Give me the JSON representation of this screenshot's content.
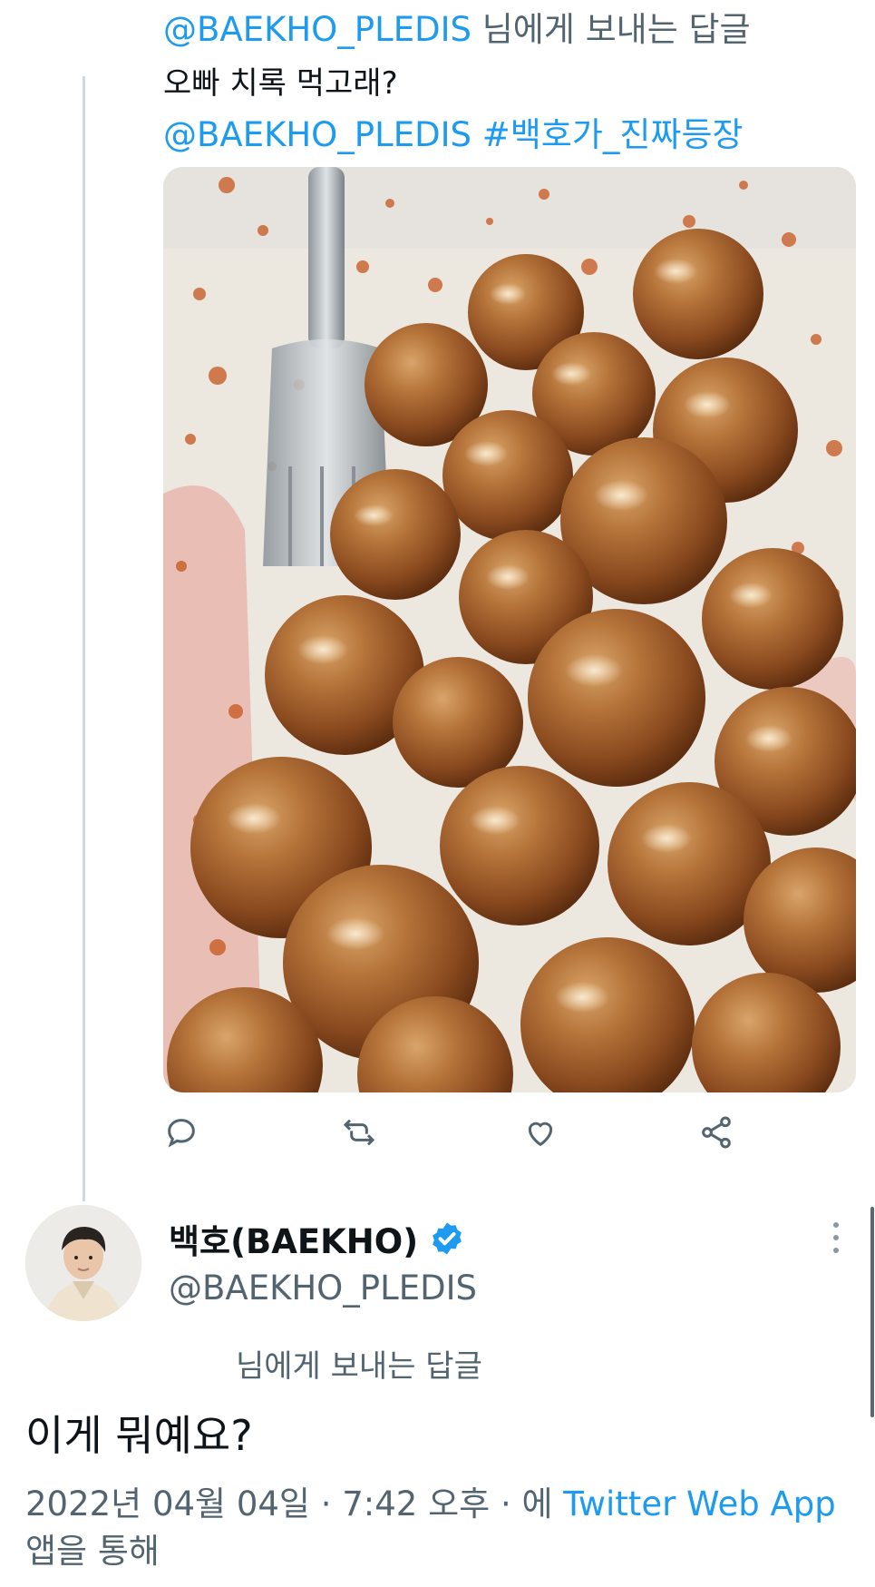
{
  "parent_tweet": {
    "reply_to_handle": "@BAEKHO_PLEDIS",
    "reply_to_suffix": " 님에게 보내는 답글",
    "text_line1": "오빠 치록 먹고래?",
    "mention": "@BAEKHO_PLEDIS",
    "hashtag": " #백호가_진짜등장",
    "image_icon": "photo-of-glazed-fried-balls-with-fork"
  },
  "actions": [
    "reply-icon",
    "retweet-icon",
    "like-icon",
    "share-icon"
  ],
  "main_tweet": {
    "display_name": "백호(BAEKHO)",
    "verified": true,
    "handle": "@BAEKHO_PLEDIS",
    "reply_label": "님에게 보내는 답글",
    "text": "이게 뭐예요?",
    "timestamp": "2022년 04월 04일 · 7:42 오후 · 에",
    "via_app": "Twitter Web App",
    "via_suffix": "앱을 통해"
  },
  "colors": {
    "accent": "#1d9bf0",
    "secondary_text": "#536471",
    "primary_text": "#0f1419",
    "thread_line": "#cfd9de"
  }
}
